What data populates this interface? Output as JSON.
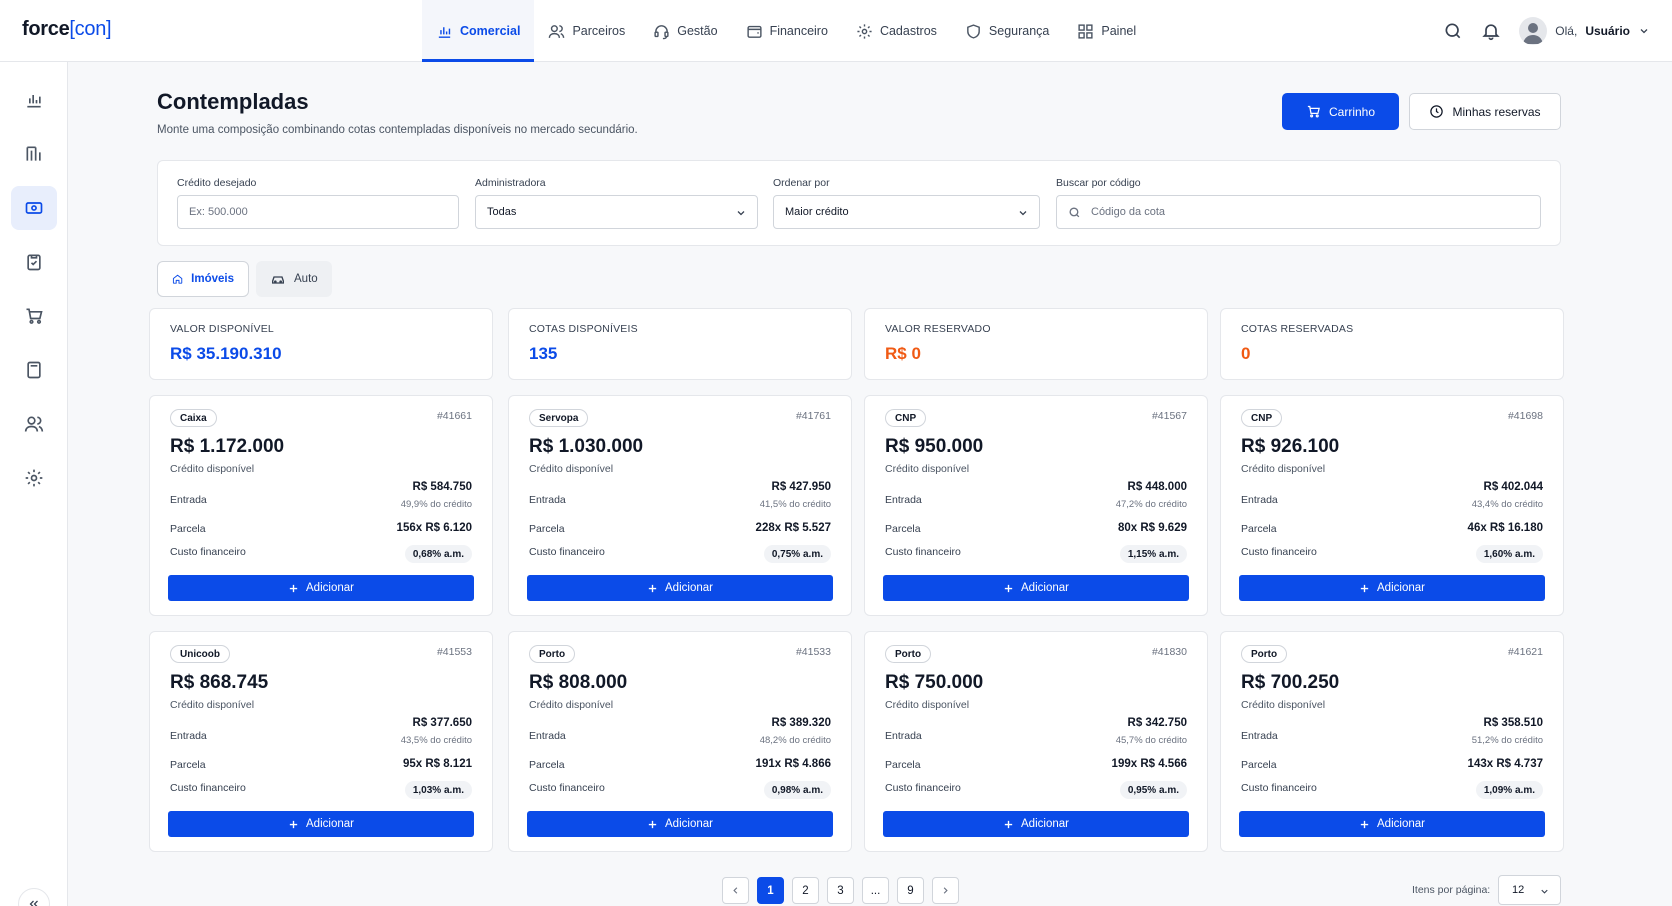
{
  "app": {
    "logo_main": "force",
    "logo_bracket": "[con]"
  },
  "nav": [
    {
      "label": "Comercial",
      "icon": "chart-bar-icon",
      "active": true
    },
    {
      "label": "Parceiros",
      "icon": "users-icon"
    },
    {
      "label": "Gestão",
      "icon": "headset-icon"
    },
    {
      "label": "Financeiro",
      "icon": "wallet-icon"
    },
    {
      "label": "Cadastros",
      "icon": "gear-icon"
    },
    {
      "label": "Segurança",
      "icon": "shield-icon"
    },
    {
      "label": "Painel",
      "icon": "grid-icon"
    }
  ],
  "user": {
    "greeting": "Olá,",
    "name": "Usuário"
  },
  "sidebar": [
    {
      "icon": "chart-bar-icon"
    },
    {
      "icon": "funnel-bars-icon"
    },
    {
      "icon": "cash-icon",
      "active": true
    },
    {
      "icon": "clipboard-check-icon"
    },
    {
      "icon": "cart-icon"
    },
    {
      "icon": "calculator-icon"
    },
    {
      "icon": "users-icon"
    },
    {
      "icon": "gear-icon"
    }
  ],
  "header": {
    "title": "Contempladas",
    "subtitle": "Monte uma composição combinando cotas contempladas disponíveis no mercado secundário.",
    "cart_label": "Carrinho",
    "reservations_label": "Minhas reservas"
  },
  "filters": {
    "credit": {
      "label": "Crédito desejado",
      "placeholder": "Ex: 500.000"
    },
    "admin": {
      "label": "Administradora",
      "value": "Todas"
    },
    "order": {
      "label": "Ordenar por",
      "value": "Maior crédito"
    },
    "search": {
      "label": "Buscar por código",
      "placeholder": "Código da cota"
    }
  },
  "tabs": {
    "real_estate": "Imóveis",
    "auto": "Auto"
  },
  "stats": [
    {
      "label": "VALOR DISPONÍVEL",
      "value": "R$ 35.190.310",
      "color": "#0b4be8"
    },
    {
      "label": "COTAS DISPONÍVEIS",
      "value": "135",
      "color": "#0b4be8"
    },
    {
      "label": "VALOR RESERVADO",
      "value": "R$ 0",
      "color": "#f05a14"
    },
    {
      "label": "COTAS RESERVADAS",
      "value": "0",
      "color": "#f05a14"
    }
  ],
  "card_labels": {
    "credit": "Crédito disponível",
    "entry": "Entrada",
    "installment": "Parcela",
    "cost": "Custo financeiro",
    "add": "Adicionar"
  },
  "cards": [
    {
      "admin": "Caixa",
      "code": "#41661",
      "credit": "R$ 1.172.000",
      "entry": "R$ 584.750",
      "entry_pct": "49,9% do crédito",
      "installment": "156x R$ 6.120",
      "cost": "0,68% a.m."
    },
    {
      "admin": "Servopa",
      "code": "#41761",
      "credit": "R$ 1.030.000",
      "entry": "R$ 427.950",
      "entry_pct": "41,5% do crédito",
      "installment": "228x R$ 5.527",
      "cost": "0,75% a.m."
    },
    {
      "admin": "CNP",
      "code": "#41567",
      "credit": "R$ 950.000",
      "entry": "R$ 448.000",
      "entry_pct": "47,2% do crédito",
      "installment": "80x R$ 9.629",
      "cost": "1,15% a.m."
    },
    {
      "admin": "CNP",
      "code": "#41698",
      "credit": "R$ 926.100",
      "entry": "R$ 402.044",
      "entry_pct": "43,4% do crédito",
      "installment": "46x R$ 16.180",
      "cost": "1,60% a.m."
    },
    {
      "admin": "Unicoob",
      "code": "#41553",
      "credit": "R$ 868.745",
      "entry": "R$ 377.650",
      "entry_pct": "43,5% do crédito",
      "installment": "95x R$ 8.121",
      "cost": "1,03% a.m."
    },
    {
      "admin": "Porto",
      "code": "#41533",
      "credit": "R$ 808.000",
      "entry": "R$ 389.320",
      "entry_pct": "48,2% do crédito",
      "installment": "191x R$ 4.866",
      "cost": "0,98% a.m."
    },
    {
      "admin": "Porto",
      "code": "#41830",
      "credit": "R$ 750.000",
      "entry": "R$ 342.750",
      "entry_pct": "45,7% do crédito",
      "installment": "199x R$ 4.566",
      "cost": "0,95% a.m."
    },
    {
      "admin": "Porto",
      "code": "#41621",
      "credit": "R$ 700.250",
      "entry": "R$ 358.510",
      "entry_pct": "51,2% do crédito",
      "installment": "143x R$ 4.737",
      "cost": "1,09% a.m."
    }
  ],
  "pagination": {
    "pages": [
      "1",
      "2",
      "3",
      "...",
      "9"
    ],
    "current": "1",
    "per_page_label": "Itens por página:",
    "per_page": "12"
  }
}
